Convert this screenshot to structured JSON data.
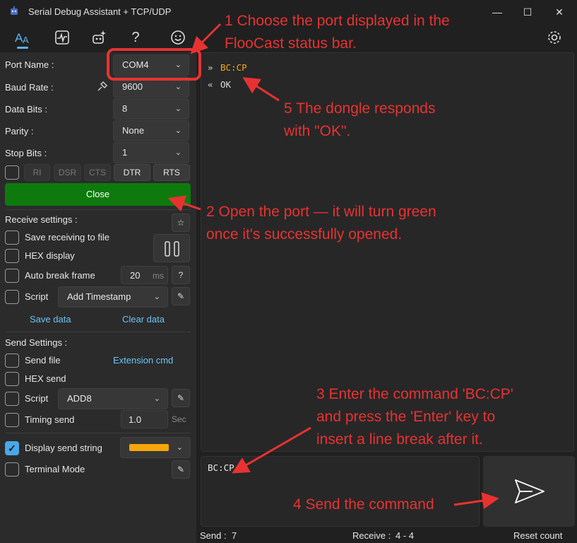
{
  "window": {
    "title": "Serial Debug Assistant + TCP/UDP",
    "app_icon": "robot-icon",
    "controls": [
      "minimize-icon",
      "maximize-icon",
      "close-icon"
    ]
  },
  "toolbar": {
    "icons": [
      "font-icon",
      "pulse-icon",
      "sparkle-robot-icon",
      "help-icon",
      "smiley-icon"
    ],
    "settings_icon": "gear-icon"
  },
  "port": {
    "port_name_label": "Port Name :",
    "port_name_value": "COM4",
    "baud_rate_label": "Baud Rate :",
    "baud_rate_value": "9600",
    "data_bits_label": "Data Bits :",
    "data_bits_value": "8",
    "parity_label": "Parity :",
    "parity_value": "None",
    "stop_bits_label": "Stop Bits :",
    "stop_bits_value": "1",
    "signals": [
      "RI",
      "DSR",
      "CTS",
      "DTR",
      "RTS"
    ],
    "close_label": "Close",
    "close_color": "#0e7a0d"
  },
  "receive": {
    "title": "Receive settings :",
    "save_to_file": "Save receiving to file",
    "hex_display": "HEX display",
    "auto_break": "Auto break frame",
    "auto_break_value": "20",
    "auto_break_unit": "ms",
    "help": "?",
    "script_label": "Script",
    "script_value": "Add Timestamp",
    "save_data": "Save data",
    "clear_data": "Clear data",
    "pause": "‖"
  },
  "send": {
    "title": "Send Settings :",
    "send_file": "Send file",
    "extension_cmd": "Extension cmd",
    "hex_send": "HEX send",
    "script_label": "Script",
    "script_value": "ADD8",
    "timing_send": "Timing send",
    "timing_value": "1.0",
    "timing_unit": "Sec",
    "display_send_string": "Display send string",
    "display_color": "#f5a60a",
    "terminal_mode": "Terminal Mode"
  },
  "log": [
    {
      "dir": "»",
      "text": "BC:CP",
      "color": "#f5a623"
    },
    {
      "dir": "«",
      "text": "OK",
      "color": "#dcdcdc"
    }
  ],
  "input": {
    "text": "BC:CP"
  },
  "status": {
    "send_label": "Send :",
    "send_count": "7",
    "receive_label": "Receive :",
    "receive_count": "4  -  4",
    "reset": "Reset count"
  },
  "annotations": {
    "a1_line1": "1 Choose the port displayed in the",
    "a1_line2": "FlooCast status bar.",
    "a2_line1": "2 Open the port — it will turn green",
    "a2_line2": "once it's successfully opened.",
    "a3_line1": "3 Enter the command 'BC:CP'",
    "a3_line2": "and press the 'Enter' key to",
    "a3_line3": "insert a line break after it.",
    "a4": "4 Send the command",
    "a5_line1": "5 The dongle responds",
    "a5_line2": "with \"OK\".",
    "color": "#e83232"
  }
}
